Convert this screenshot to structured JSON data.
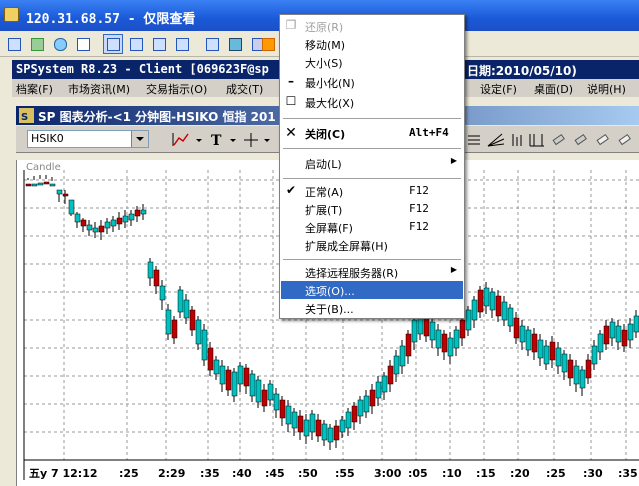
{
  "title_bar": {
    "title": "120.31.68.57 - 仅限查看"
  },
  "app": {
    "title": "SPSystem R8.23 - Client [069623F@sp",
    "date_fragment": "日期:2010/05/10)",
    "menu": [
      "档案(F)",
      "市场资讯(M)",
      "交易指示(O)",
      "成交(T)",
      "设定(F)",
      "桌面(D)",
      "说明(H)"
    ]
  },
  "chart_window": {
    "title": "SP 图表分析-<1 分钟图-HSIKO 恒指 201",
    "symbol": "HSIK0",
    "panel_label": "Candle",
    "time_labels": [
      "五y 7 12:12",
      ":25",
      "2:29",
      ":35",
      ":40",
      ":45",
      ":50",
      ":55",
      "3:00",
      ":05",
      ":10",
      ":15",
      ":20",
      ":25",
      ":30",
      ":35"
    ]
  },
  "context_menu": {
    "items": [
      {
        "label": "还原(R)",
        "disabled": true,
        "icon": "restore-icon"
      },
      {
        "label": "移动(M)"
      },
      {
        "label": "大小(S)"
      },
      {
        "label": "最小化(N)",
        "icon": "minimize-icon"
      },
      {
        "label": "最大化(X)",
        "icon": "maximize-icon"
      },
      {
        "label": "关闭(C)",
        "shortcut": "Alt+F4",
        "bold": true,
        "icon": "close-icon"
      },
      {
        "label": "启动(L)",
        "submenu": true
      },
      {
        "label": "正常(A)",
        "shortcut": "F12",
        "checked": true
      },
      {
        "label": "扩展(T)",
        "shortcut": "F12"
      },
      {
        "label": "全屏幕(F)",
        "shortcut": "F12"
      },
      {
        "label": "扩展成全屏幕(H)"
      },
      {
        "label": "选择远程服务器(R)",
        "submenu": true
      },
      {
        "label": "选项(O)...",
        "highlighted": true
      },
      {
        "label": "关于(B)..."
      }
    ]
  },
  "colors": {
    "bull": "#00c0c0",
    "bear": "#c00000",
    "highlight": "#316ac5",
    "title": "#0a246a"
  }
}
